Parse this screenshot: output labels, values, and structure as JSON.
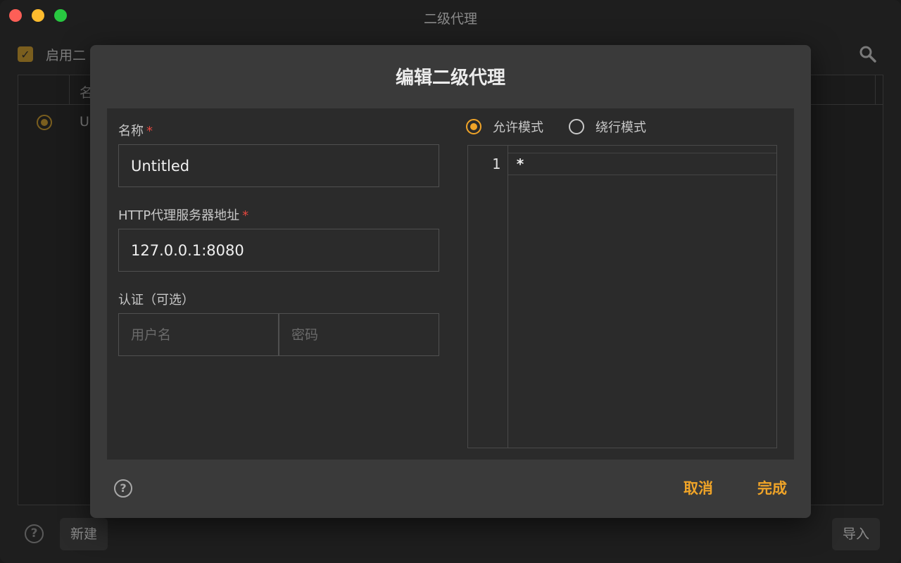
{
  "window": {
    "title": "二级代理"
  },
  "background": {
    "enable_label": "启用二",
    "table_header": "名",
    "row_label": "U",
    "new_button": "新建",
    "import_button": "导入"
  },
  "dialog": {
    "title": "编辑二级代理",
    "name_label": "名称",
    "name_value": "Untitled",
    "server_label": "HTTP代理服务器地址",
    "server_value": "127.0.0.1:8080",
    "required_mark": "*",
    "auth_label": "认证（可选）",
    "username_placeholder": "用户名",
    "password_placeholder": "密码",
    "mode_allow": "允许模式",
    "mode_bypass": "绕行模式",
    "selected_mode": "允许模式",
    "editor": {
      "line_number": "1",
      "line_text": "*"
    },
    "cancel_button": "取消",
    "done_button": "完成"
  },
  "colors": {
    "accent": "#f0a428",
    "required": "#e5473f"
  },
  "icons": {
    "help": "help-circle-icon",
    "search": "search-icon",
    "check": "checkmark-icon"
  }
}
